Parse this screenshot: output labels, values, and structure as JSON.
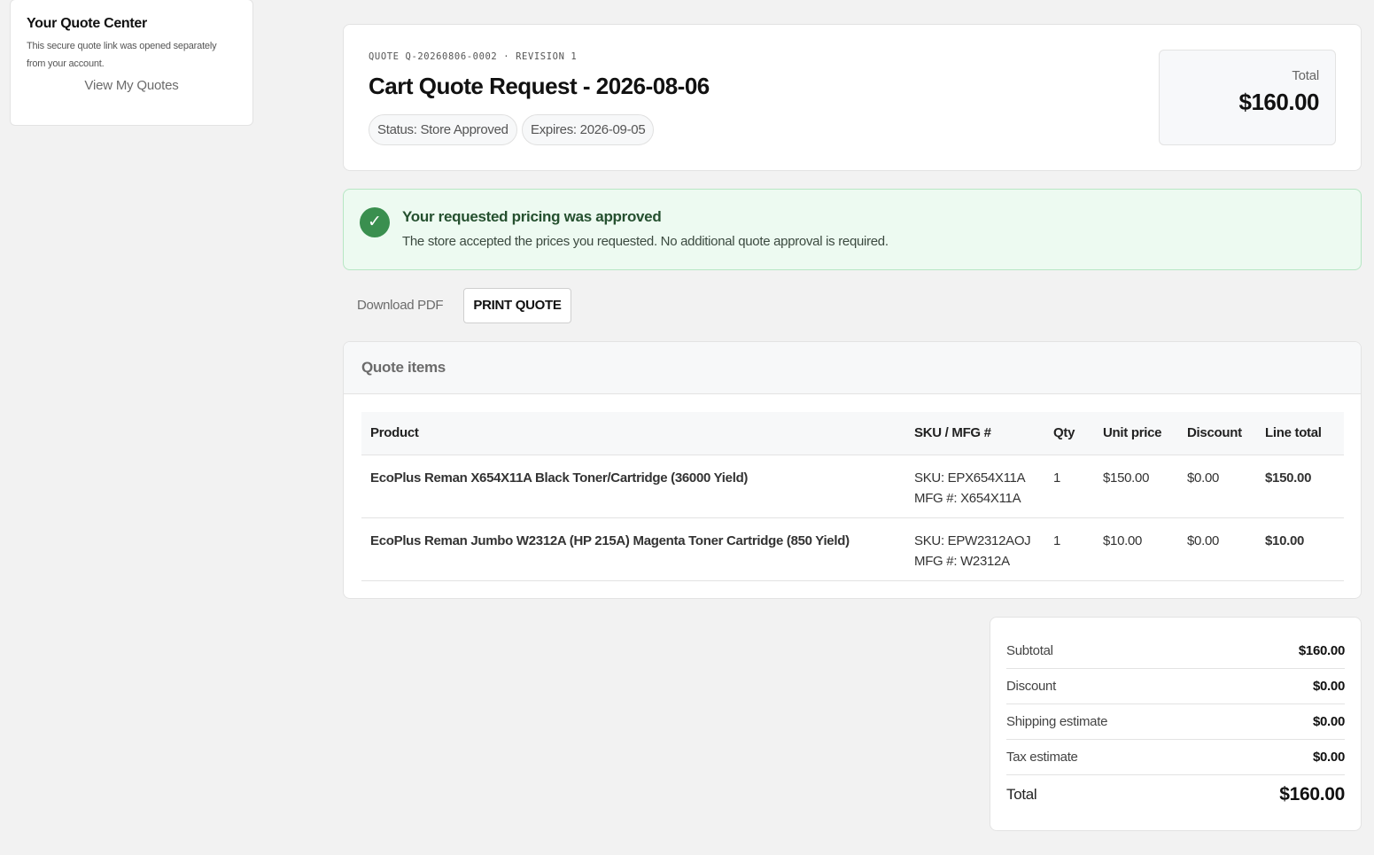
{
  "sidebar": {
    "title": "Your Quote Center",
    "description": "This secure quote link was opened separately from your account.",
    "view_link": "View My Quotes"
  },
  "header": {
    "quote_number": "QUOTE Q-20260806-0002 · REVISION 1",
    "title": "Cart Quote Request - 2026-08-06",
    "status": "Status: Store Approved",
    "expires": "Expires: 2026-09-05",
    "total_label": "Total",
    "total_value": "$160.00"
  },
  "alert": {
    "icon": "check-icon",
    "title": "Your requested pricing was approved",
    "message": "The store accepted the prices you requested. No additional quote approval is required.",
    "accent": "#3a8f4f"
  },
  "actions": {
    "download": "Download PDF",
    "print": "PRINT QUOTE"
  },
  "items": {
    "heading": "Quote items",
    "columns": [
      "Product",
      "SKU / MFG #",
      "Qty",
      "Unit price",
      "Discount",
      "Line total"
    ],
    "rows": [
      {
        "product": "EcoPlus Reman X654X11A Black Toner/Cartridge (36000 Yield)",
        "sku": "SKU: EPX654X11A",
        "mfg": "MFG #: X654X11A",
        "qty": "1",
        "unit_price": "$150.00",
        "discount": "$0.00",
        "line_total": "$150.00"
      },
      {
        "product": "EcoPlus Reman Jumbo W2312A (HP 215A) Magenta Toner Cartridge (850 Yield)",
        "sku": "SKU: EPW2312AOJ",
        "mfg": "MFG #: W2312A",
        "qty": "1",
        "unit_price": "$10.00",
        "discount": "$0.00",
        "line_total": "$10.00"
      }
    ]
  },
  "summary": {
    "subtotal_label": "Subtotal",
    "subtotal": "$160.00",
    "discount_label": "Discount",
    "discount": "$0.00",
    "shipping_label": "Shipping estimate",
    "shipping": "$0.00",
    "tax_label": "Tax estimate",
    "tax": "$0.00",
    "total_label": "Total",
    "total": "$160.00"
  }
}
